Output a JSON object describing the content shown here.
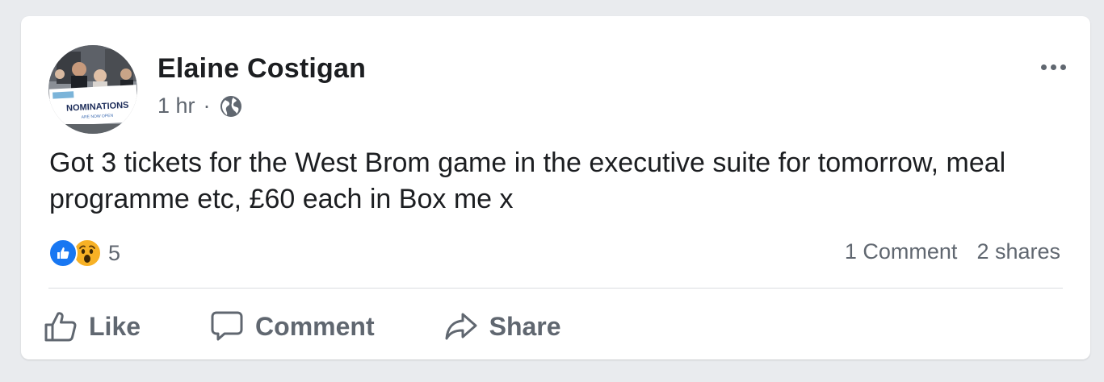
{
  "post": {
    "author": "Elaine Costigan",
    "time": "1 hr",
    "separator": "·",
    "privacy_icon": "globe-icon",
    "text": "Got 3 tickets for the West Brom game in the executive suite for tomorrow, meal programme etc, £60 each in Box me x",
    "avatar": {
      "sign_text": "NOMINATIONS",
      "sign_subtext": "ARE NOW OPEN"
    }
  },
  "reactions": {
    "types": [
      "like",
      "wow"
    ],
    "count": "5"
  },
  "stats": {
    "comments": "1 Comment",
    "shares": "2 shares"
  },
  "actions": {
    "like": "Like",
    "comment": "Comment",
    "share": "Share"
  },
  "colors": {
    "background": "#e9ebee",
    "card": "#ffffff",
    "text_primary": "#1c1e21",
    "text_secondary": "#606770",
    "like_blue": "#1877f2",
    "wow_yellow": "#f7b125"
  }
}
